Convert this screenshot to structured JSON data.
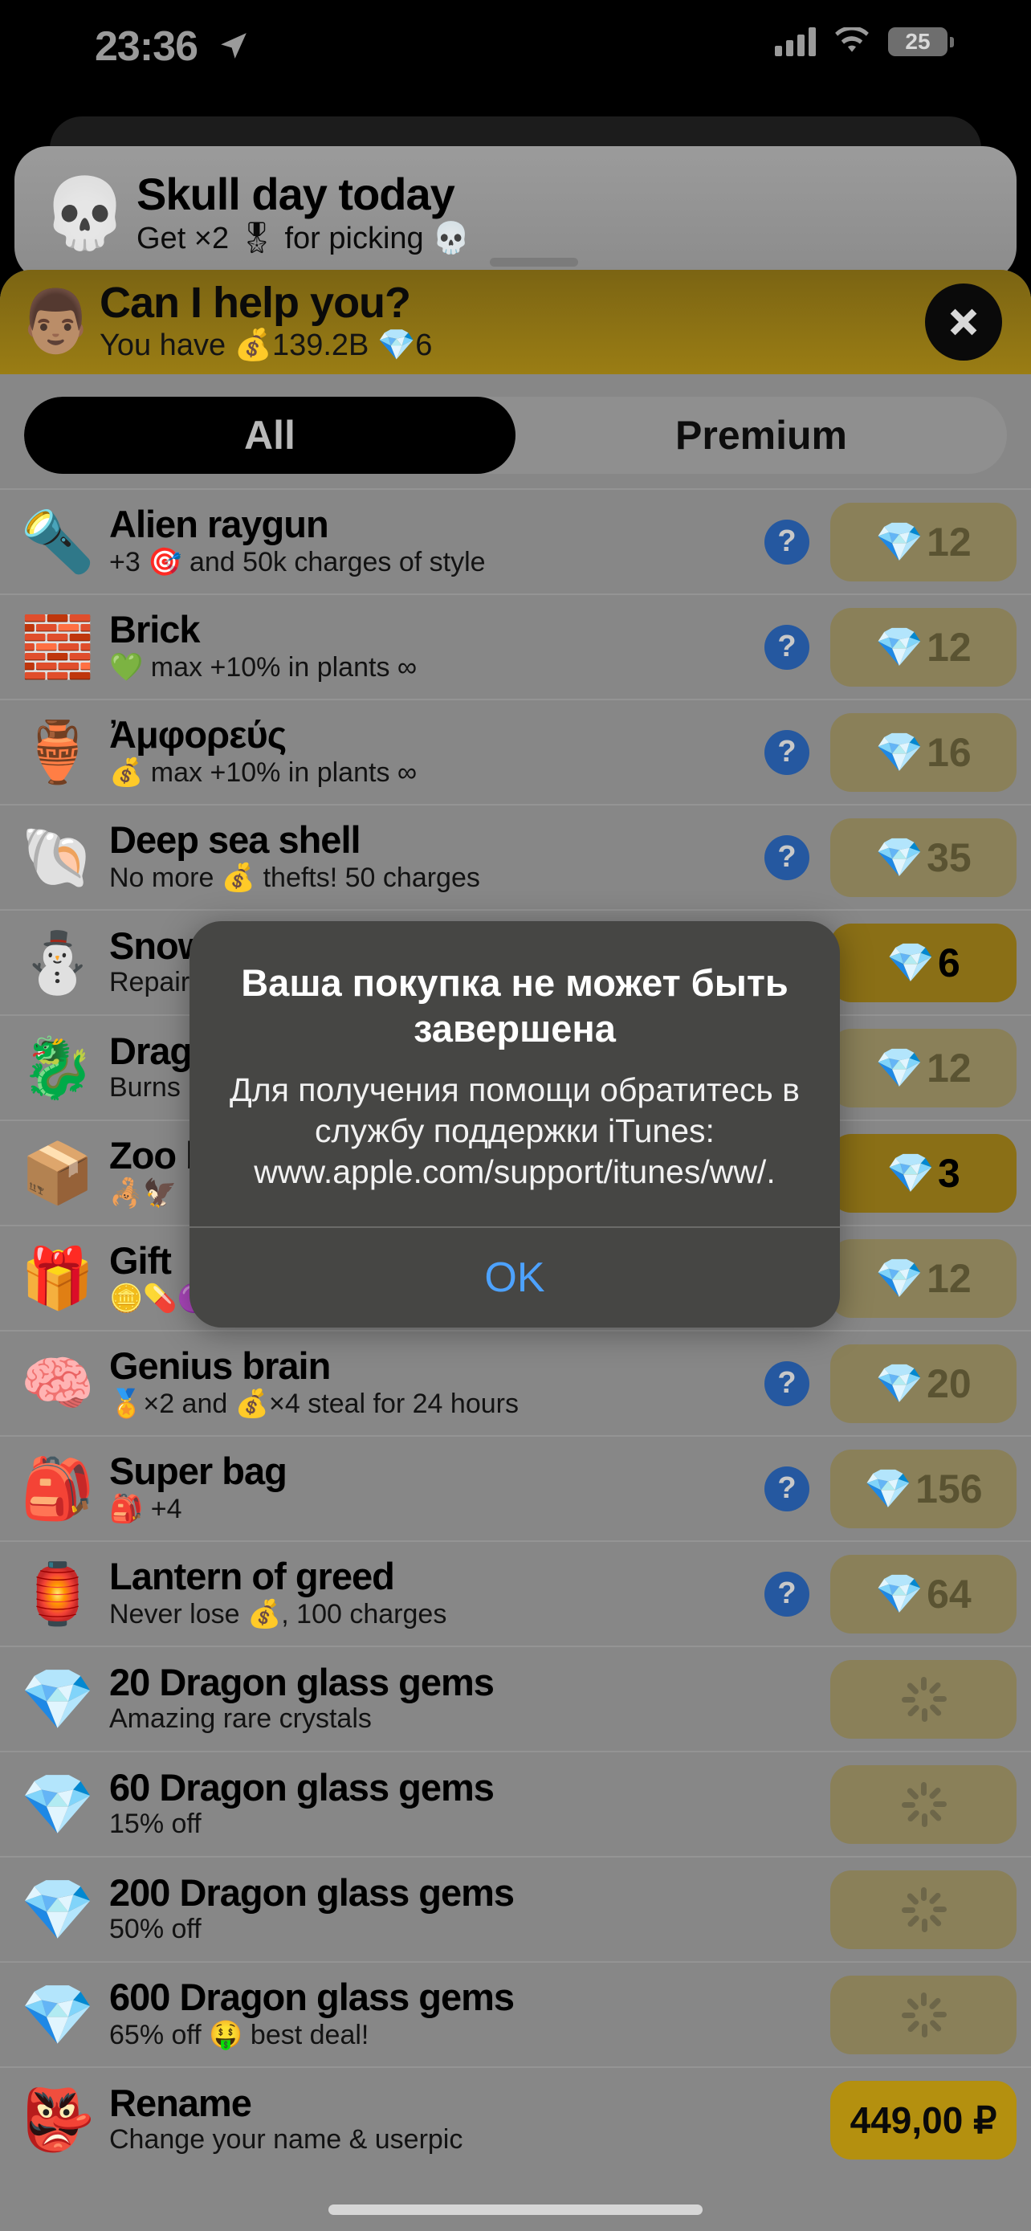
{
  "status_bar": {
    "time": "23:36",
    "battery": "25",
    "location_icon": "location-arrow-icon",
    "cellular_icon": "cellular-bars-icon",
    "wifi_icon": "wifi-icon"
  },
  "notification": {
    "icon": "💀",
    "title": "Skull day today",
    "subtitle": "Get ×2 🎖 for picking 💀"
  },
  "shop_header": {
    "avatar": "👨🏽",
    "title": "Can I help you?",
    "balance": "You have 💰139.2B 💎6",
    "close_label": "close-icon"
  },
  "tabs": [
    {
      "label": "All",
      "active": true
    },
    {
      "label": "Premium",
      "active": false
    }
  ],
  "items": [
    {
      "icon": "🔦",
      "title": "Alien raygun",
      "subtitle": "+3 🎯 and 50k charges of style",
      "help": true,
      "price": "12",
      "gem": "💎",
      "state": "dim"
    },
    {
      "icon": "🧱",
      "title": "Brick",
      "subtitle": "💚 max +10% in plants ∞",
      "help": true,
      "price": "12",
      "gem": "💎",
      "state": "dim"
    },
    {
      "icon": "🏺",
      "title": "Ἀμφορεύς",
      "subtitle": "💰 max +10% in plants ∞",
      "help": true,
      "price": "16",
      "gem": "💎",
      "state": "dim"
    },
    {
      "icon": "🐚",
      "title": "Deep sea shell",
      "subtitle": "No more 💰 thefts! 50 charges",
      "help": true,
      "price": "35",
      "gem": "💎",
      "state": "dim"
    },
    {
      "icon": "⛄",
      "title": "Snowman",
      "subtitle": "Repairs",
      "help": true,
      "price": "6",
      "gem": "💎",
      "state": "bright"
    },
    {
      "icon": "🐉",
      "title": "Dragon",
      "subtitle": "Burns",
      "help": true,
      "price": "12",
      "gem": "💎",
      "state": "dim"
    },
    {
      "icon": "📦",
      "title": "Zoo box",
      "subtitle": "🦂🦅",
      "help": true,
      "price": "3",
      "gem": "💎",
      "state": "bright"
    },
    {
      "icon": "🎁",
      "title": "Gift",
      "subtitle": "🪙💊🟣🟣🔴🟣🟢",
      "help": true,
      "price": "12",
      "gem": "💎",
      "state": "dim"
    },
    {
      "icon": "🧠",
      "title": "Genius brain",
      "subtitle": "🏅×2 and 💰×4 steal for 24 hours",
      "help": true,
      "price": "20",
      "gem": "💎",
      "state": "dim"
    },
    {
      "icon": "🎒",
      "title": "Super bag",
      "subtitle": "🎒 +4",
      "help": true,
      "price": "156",
      "gem": "💎",
      "state": "dim"
    },
    {
      "icon": "🏮",
      "title": "Lantern of greed",
      "subtitle": "Never lose 💰, 100 charges",
      "help": true,
      "price": "64",
      "gem": "💎",
      "state": "dim"
    },
    {
      "icon": "💎",
      "title": "20 Dragon glass gems",
      "subtitle": "Amazing rare crystals",
      "help": false,
      "price": "",
      "gem": "",
      "state": "loading"
    },
    {
      "icon": "💎",
      "title": "60 Dragon glass gems",
      "subtitle": "15% off",
      "help": false,
      "price": "",
      "gem": "",
      "state": "loading"
    },
    {
      "icon": "💎",
      "title": "200 Dragon glass gems",
      "subtitle": "50% off",
      "help": false,
      "price": "",
      "gem": "",
      "state": "loading"
    },
    {
      "icon": "💎",
      "title": "600 Dragon glass gems",
      "subtitle": "65% off 🤑 best deal!",
      "help": false,
      "price": "",
      "gem": "",
      "state": "loading"
    },
    {
      "icon": "👺",
      "title": "Rename",
      "subtitle": "Change your name & userpic",
      "help": false,
      "price": "449,00 ₽",
      "gem": "",
      "state": "money"
    }
  ],
  "alert": {
    "title": "Ваша покупка не может быть завершена",
    "message": "Для получения помощи обратитесь в службу поддержки iTunes: www.apple.com/support/itunes/ww/.",
    "ok_label": "OK"
  },
  "colors": {
    "accent_gold": "#8a6f16",
    "dim_gold": "#8a8059",
    "money_gold": "#b4900f",
    "help_blue": "#2558a0",
    "alert_link": "#4da2ff",
    "list_bg": "#878787"
  }
}
